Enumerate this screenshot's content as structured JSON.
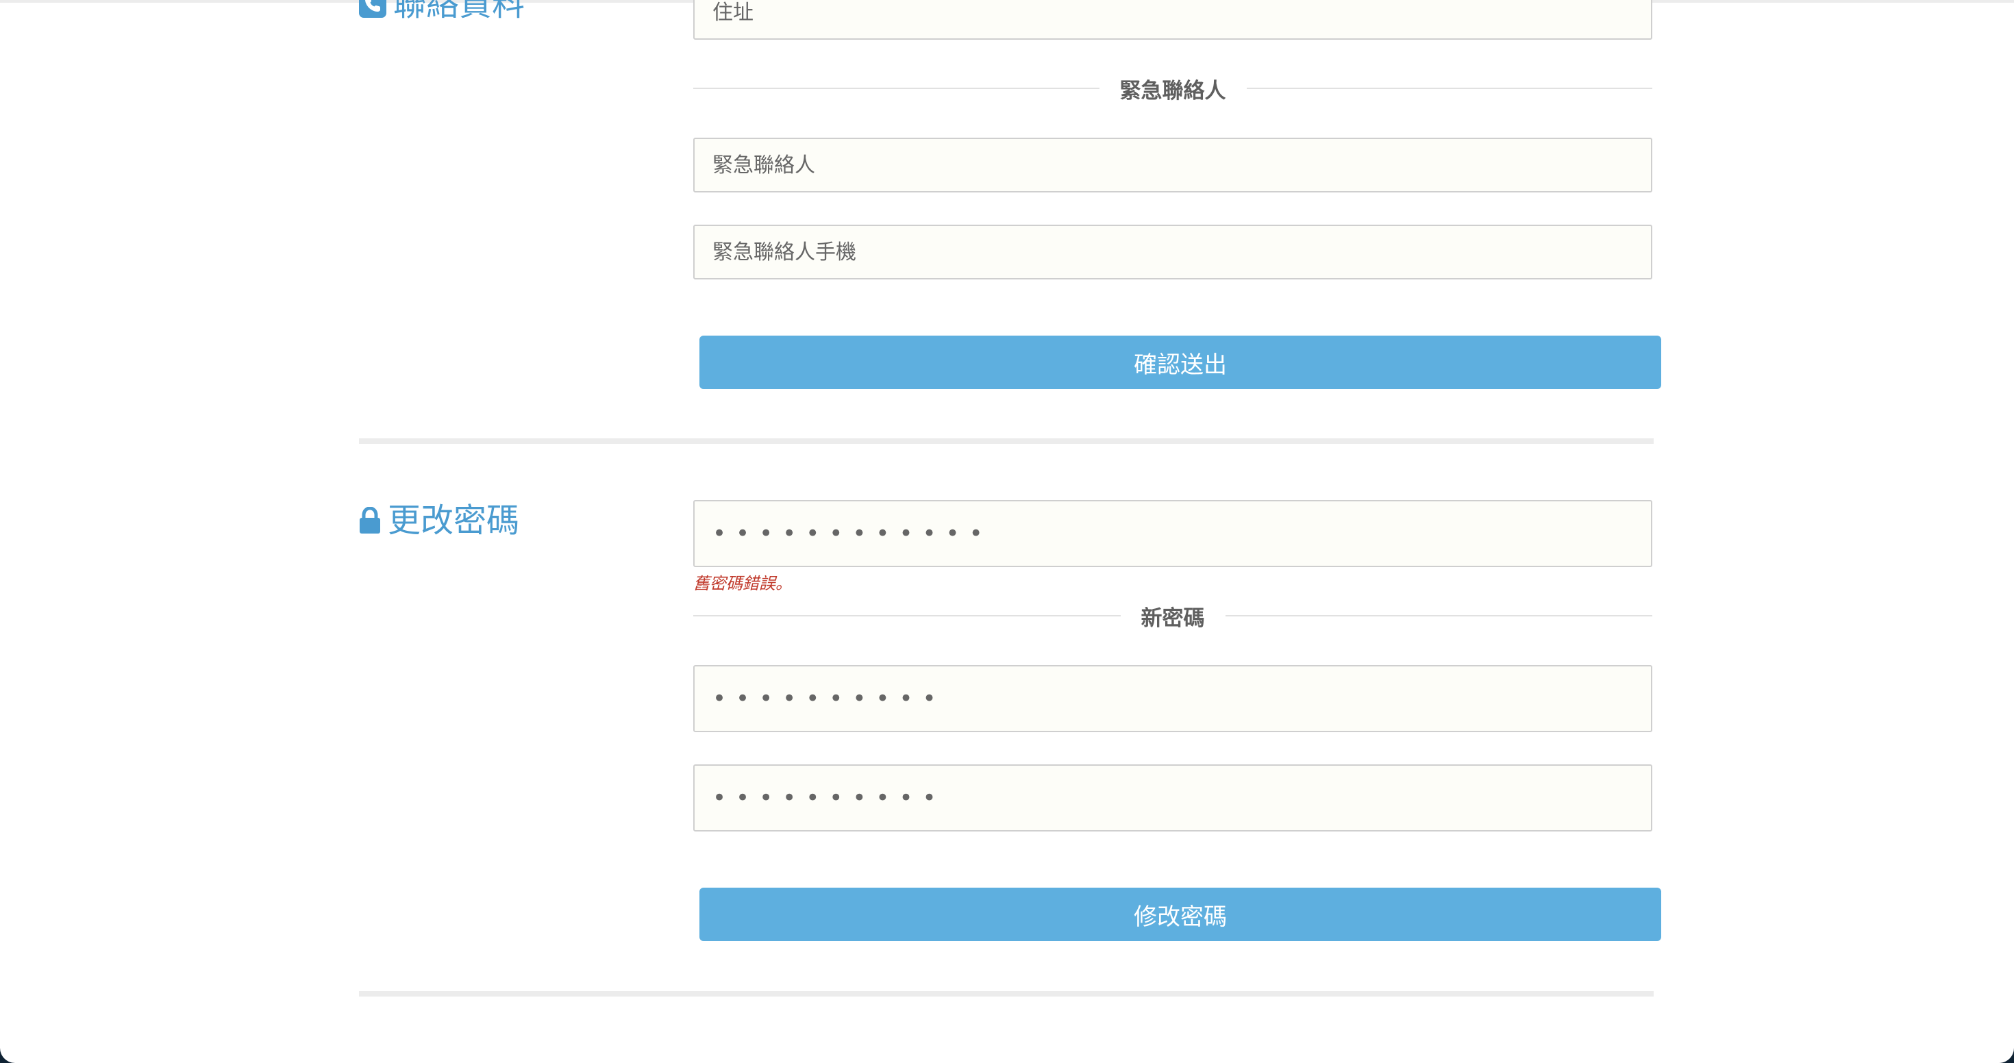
{
  "contact_section": {
    "title": "聯絡資料",
    "icon": "phone-icon",
    "address": {
      "placeholder": "住址"
    },
    "emergency_divider_label": "緊急聯絡人",
    "emergency_contact": {
      "placeholder": "緊急聯絡人"
    },
    "emergency_phone": {
      "placeholder": "緊急聯絡人手機"
    },
    "submit_label": "確認送出"
  },
  "password_section": {
    "title": "更改密碼",
    "icon": "lock-icon",
    "old_password": {
      "value": "••••••••••••"
    },
    "error_text": "舊密碼錯誤。",
    "new_password_divider_label": "新密碼",
    "new_password": {
      "value": "••••••••••"
    },
    "confirm_password": {
      "value": "••••••••••"
    },
    "submit_label": "修改密碼"
  },
  "colors": {
    "accent": "#4a9bd0",
    "button": "#5eafdf",
    "error": "#c0392b",
    "input_bg": "#fdfdf8"
  }
}
